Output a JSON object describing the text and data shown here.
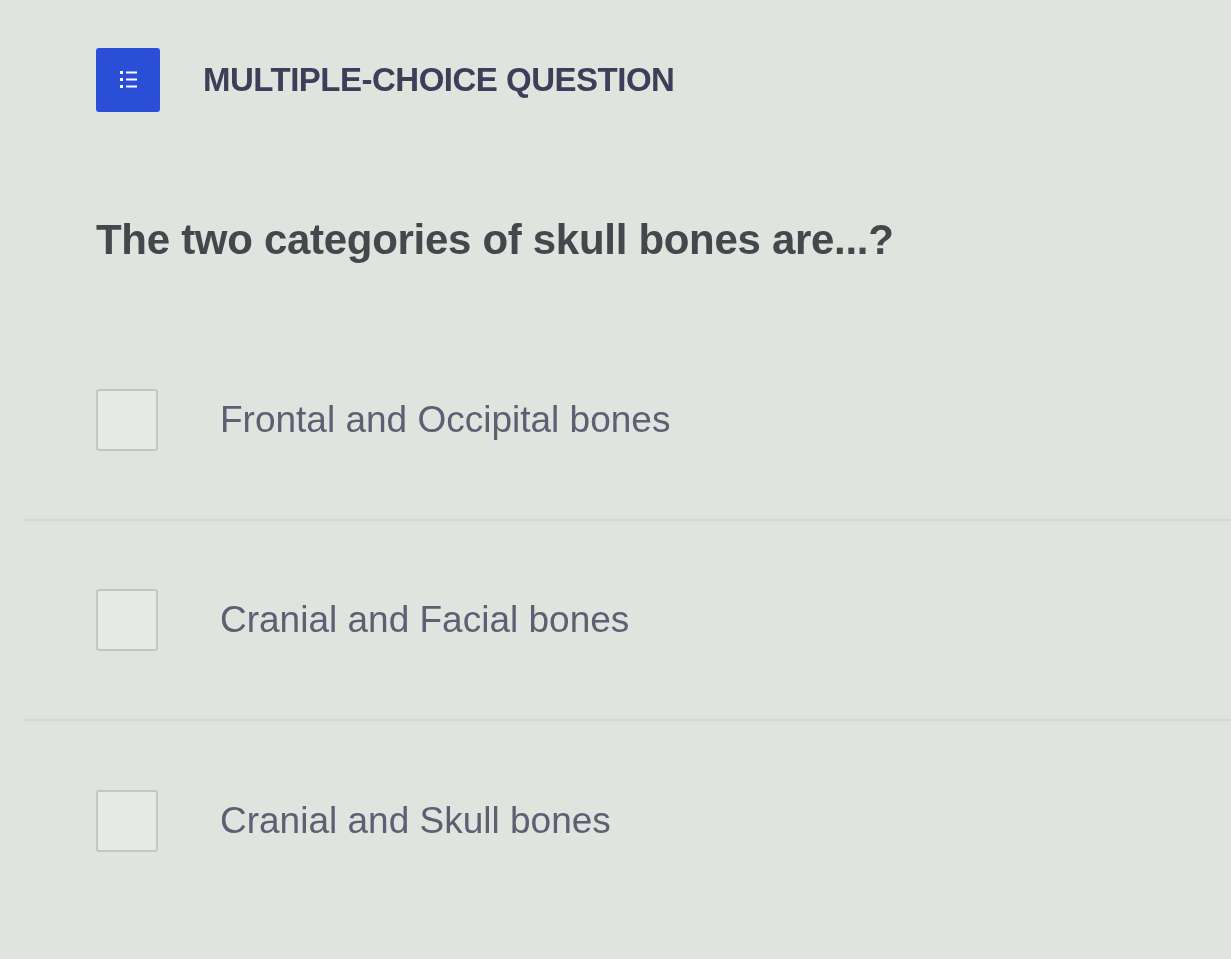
{
  "header": {
    "title": "MULTIPLE-CHOICE QUESTION"
  },
  "question": "The two categories of skull bones are...?",
  "options": [
    {
      "label": "Frontal and Occipital bones",
      "checked": false
    },
    {
      "label": "Cranial and Facial bones",
      "checked": false
    },
    {
      "label": "Cranial and Skull bones",
      "checked": false
    }
  ]
}
